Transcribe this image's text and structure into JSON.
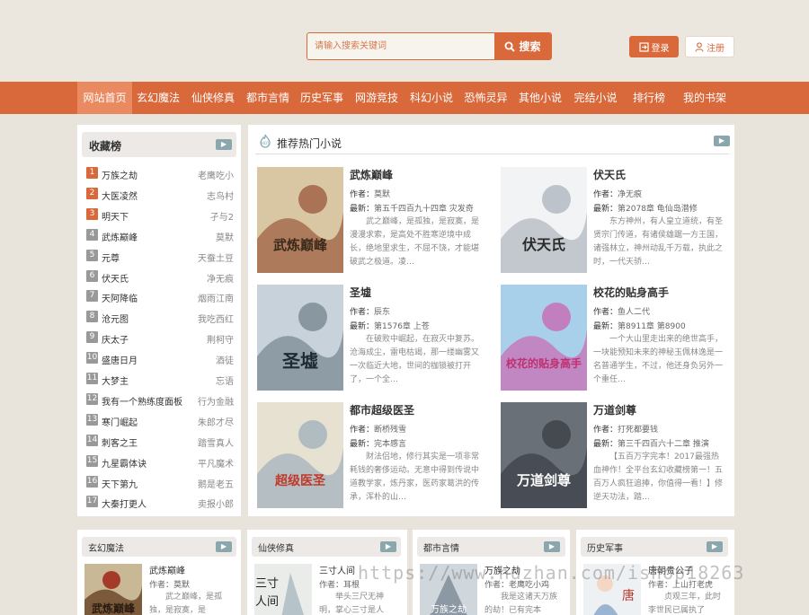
{
  "header": {
    "search_placeholder": "请输入搜索关键词",
    "search_button": "搜索",
    "login": "登录",
    "register": "注册"
  },
  "nav": {
    "items": [
      "网站首页",
      "玄幻魔法",
      "仙侠修真",
      "都市言情",
      "历史军事",
      "网游竞技",
      "科幻小说",
      "恐怖灵异",
      "其他小说",
      "完结小说",
      "排行榜",
      "我的书架"
    ],
    "active_index": 0
  },
  "rank": {
    "title": "收藏榜",
    "items": [
      {
        "num": "1",
        "title": "万族之劫",
        "author": "老鹰吃小"
      },
      {
        "num": "2",
        "title": "大医凌然",
        "author": "志鸟村"
      },
      {
        "num": "3",
        "title": "明天下",
        "author": "孑与2"
      },
      {
        "num": "4",
        "title": "武炼巅峰",
        "author": "莫默"
      },
      {
        "num": "5",
        "title": "元尊",
        "author": "天蚕土豆"
      },
      {
        "num": "6",
        "title": "伏天氏",
        "author": "净无痕"
      },
      {
        "num": "7",
        "title": "天阿降临",
        "author": "烟雨江南"
      },
      {
        "num": "8",
        "title": "沧元图",
        "author": "我吃西红"
      },
      {
        "num": "9",
        "title": "庆太子",
        "author": "荆柯守"
      },
      {
        "num": "10",
        "title": "盛唐日月",
        "author": "酒徒"
      },
      {
        "num": "11",
        "title": "大梦主",
        "author": "忘语"
      },
      {
        "num": "12",
        "title": "我有一个熟练度面板",
        "author": "行为金融"
      },
      {
        "num": "13",
        "title": "寒门崛起",
        "author": "朱郎才尽"
      },
      {
        "num": "14",
        "title": "刺客之王",
        "author": "踏雪真人"
      },
      {
        "num": "15",
        "title": "九星霸体诀",
        "author": "平凡魔术"
      },
      {
        "num": "16",
        "title": "天下第九",
        "author": "鹅是老五"
      },
      {
        "num": "17",
        "title": "大秦打更人",
        "author": "卖报小郎"
      }
    ]
  },
  "recommend": {
    "title": "推荐热门小说",
    "author_label": "作者：",
    "latest_label": "最新：",
    "books": [
      {
        "title": "武炼巅峰",
        "author": "莫默",
        "latest": "第五千四百九十四章 灾发奇",
        "desc": "武之巅峰，是孤独，是寂寞，是漫漫求索，是高处不胜寒逆境中成长，绝地里求生，不屈不饶，才能堪破武之极道。凌…",
        "cover_text": "武炼巅峰"
      },
      {
        "title": "伏天氏",
        "author": "净无痕",
        "latest": "第2078章 龟仙岛潜修",
        "desc": "东方神州，有人皇立道统，有圣贤宗门传道，有诸侯雄踞一方王国，诸强林立，神州动乱千万载，执此之时，一代天骄…",
        "cover_text": "伏天氏"
      },
      {
        "title": "圣墟",
        "author": "辰东",
        "latest": "第1576章 上苍",
        "desc": "在破败中崛起，在寂灭中复苏。沧海成尘，雷电枯竭，那一缕幽雾又一次临近大地，世间的枷锁被打开了，一个全…",
        "cover_text": "圣墟"
      },
      {
        "title": "校花的贴身高手",
        "author": "鱼人二代",
        "latest": "第8911章 第8900",
        "desc": "一个大山里走出来的绝世高手，一块能预知未来的神秘玉佩林逸是一名普通学生，不过，他还身负另外一个重任…",
        "cover_text": "校花的贴身高手"
      },
      {
        "title": "都市超级医圣",
        "author": "断桥残雪",
        "latest": "完本感言",
        "desc": "财法侣地，修行其实是一项非常耗钱的奢侈运动。无意中得到传说中道教学家，炼丹家，医药家葛洪的传承，浑朴的山…",
        "cover_text": "超级医圣"
      },
      {
        "title": "万道剑尊",
        "author": "打死都要钱",
        "latest": "第三千四百六十二章 推演",
        "desc": "【五百万字完本！2017最强热血神作！全平台玄幻收藏榜第一！五百万人疯狂追捧，你值得一看！】修逆天功法，踏…",
        "cover_text": "万道剑尊"
      }
    ]
  },
  "categories": [
    {
      "name": "玄幻魔法",
      "book": "武炼巅峰",
      "author": "作者：莫默",
      "desc": "武之巅峰，是孤独，是寂寞，是"
    },
    {
      "name": "仙侠修真",
      "book": "三寸人间",
      "author": "作者：耳根",
      "desc": "举头三尺无神明，掌心三寸是人"
    },
    {
      "name": "都市言情",
      "book": "万族之劫",
      "author": "作者：老鹰吃小鸡",
      "desc": "我是这诸天万族的劫！已有完本"
    },
    {
      "name": "历史军事",
      "book": "唐朝贵公子",
      "author": "作者：上山打老虎",
      "desc": "贞观三年，此时李世民已属执了"
    }
  ],
  "watermark": "https://www.huzhan.com/ishop18263",
  "colors": {
    "accent": "#d9693a",
    "rank_top": "#d9693a",
    "rank_other": "#999999",
    "more_button": "#8aa7ad"
  }
}
